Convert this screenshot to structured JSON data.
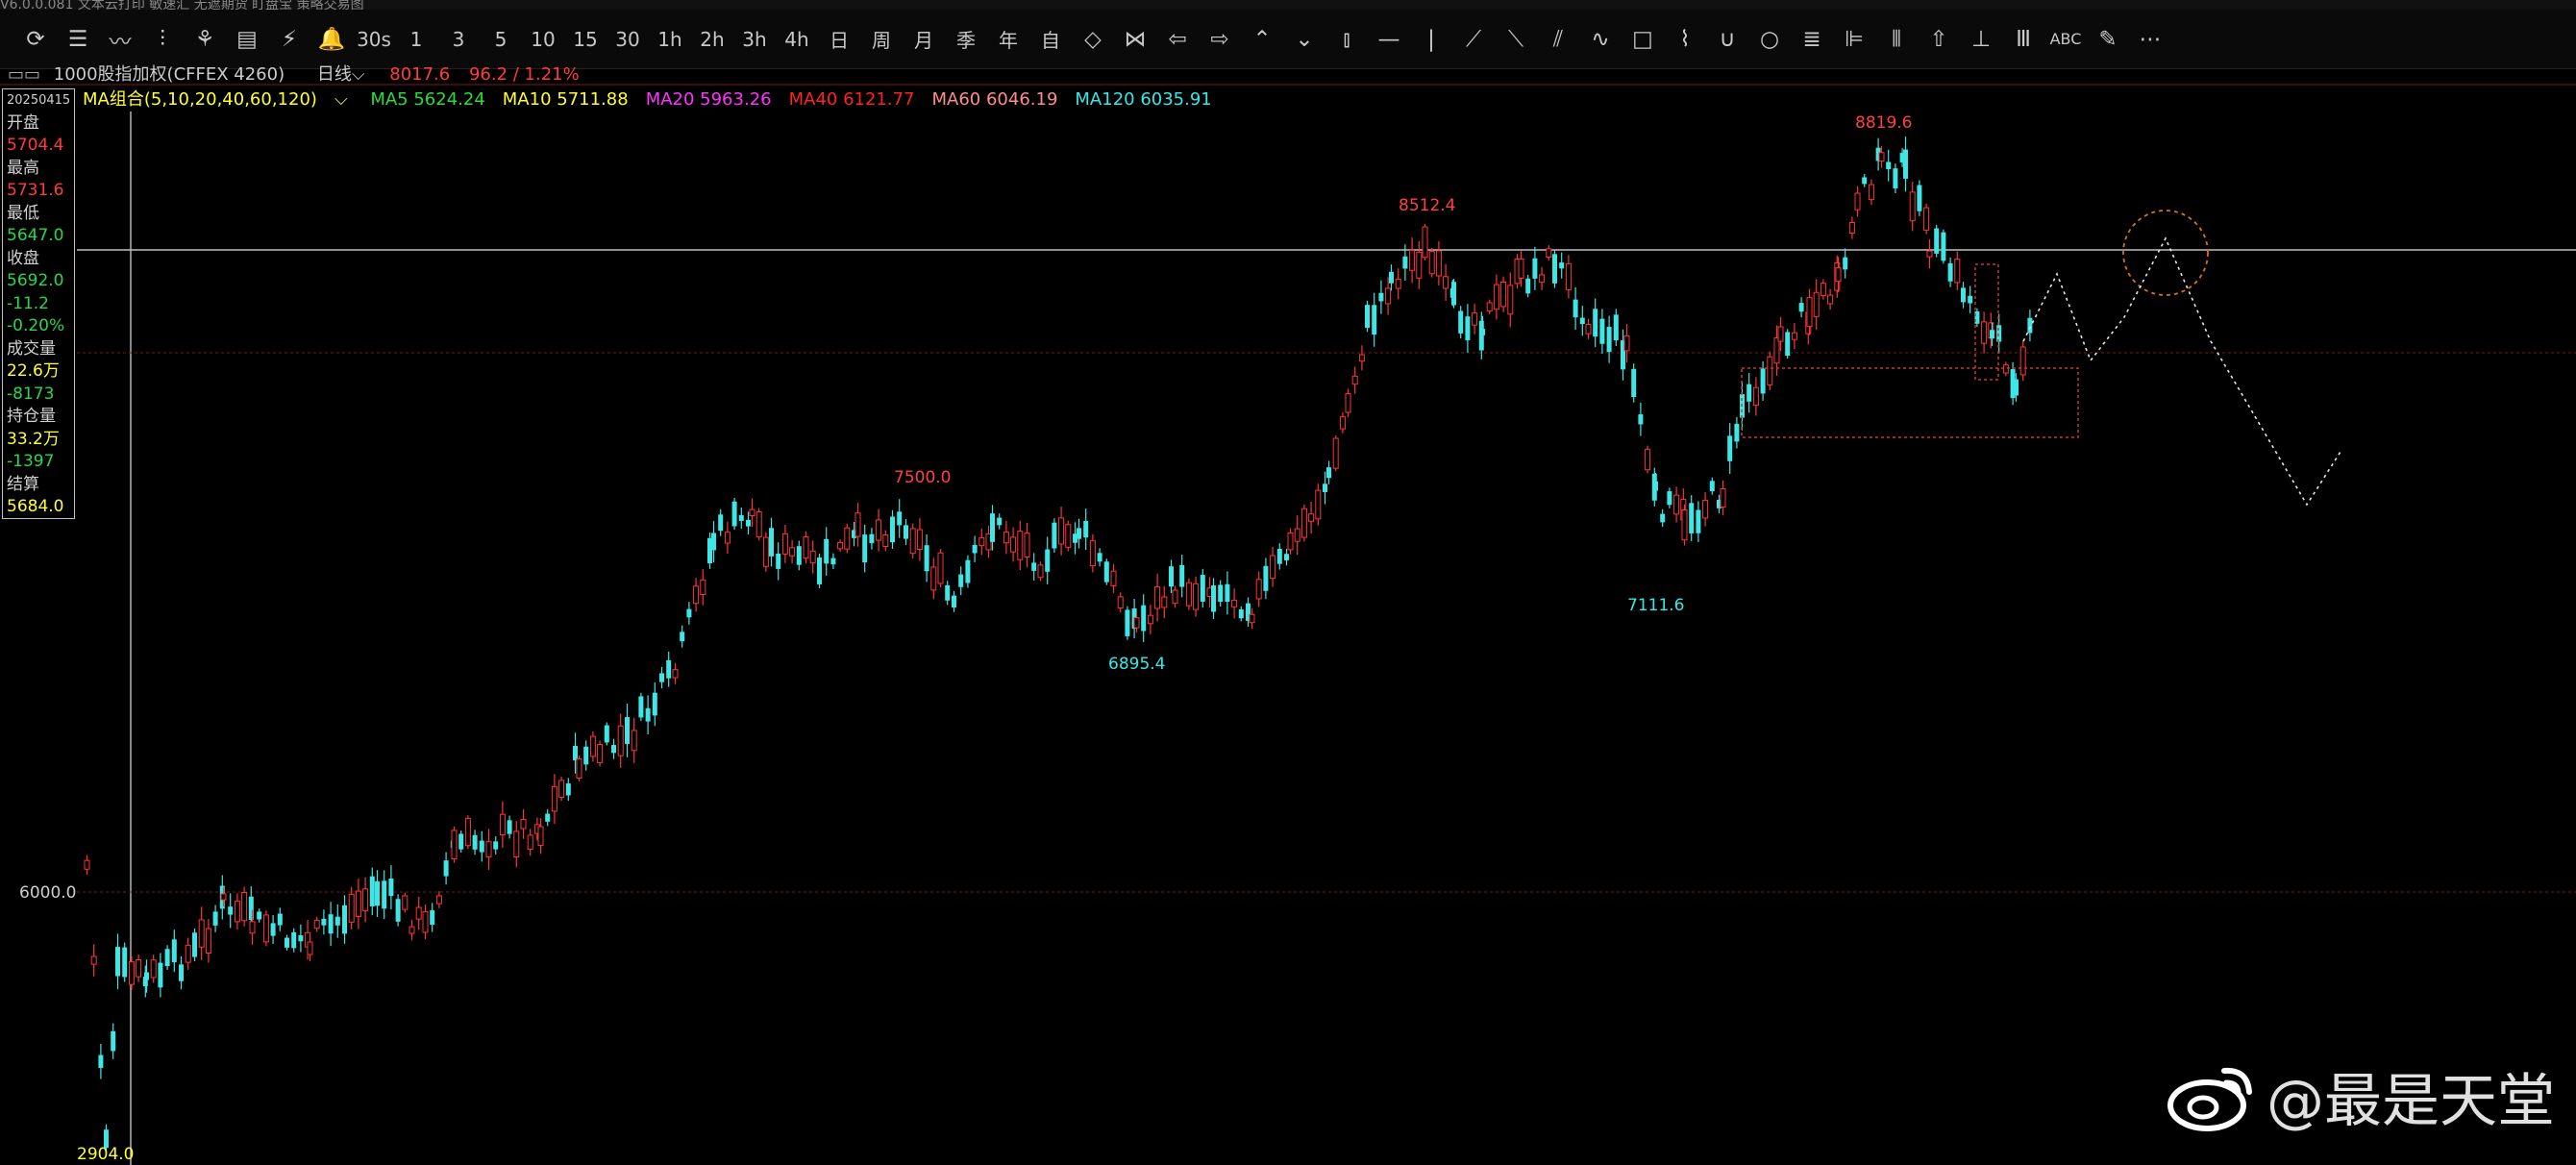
{
  "topbar": {
    "text": "V6.0.0.081    文本云打印  敏速汇    无遮期货  盯盘宝       策略交易图"
  },
  "toolbar": {
    "icons": [
      "refresh-icon",
      "list-icon",
      "line-chart-icon",
      "candlestick-icon",
      "crosshair-icon",
      "kline-icon",
      "lightning-icon",
      "bell-icon",
      "30s-text-icon",
      "1min",
      "3min",
      "5min",
      "10min",
      "15min",
      "30min",
      "1h",
      "2h",
      "3h",
      "4h",
      "day",
      "week",
      "month",
      "season",
      "year",
      "custom",
      "arrows-icon",
      "measure-icon",
      "back-icon",
      "forward-icon",
      "up-icon",
      "down-icon",
      "ruler-icon",
      "hline-icon",
      "vline-icon",
      "segment-icon",
      "ray-icon",
      "parallel-icon",
      "wave-icon",
      "rect-icon",
      "zigzag-icon",
      "arc-icon",
      "circle-icon",
      "gann-icon",
      "fib-icon",
      "period-icon",
      "arrow-up-icon",
      "volume-icon",
      "scale-icon",
      "abc-icon",
      "draw-icon",
      "more-icon"
    ],
    "labels": [
      "30s",
      "1",
      "3",
      "5",
      "10",
      "15",
      "30",
      "1h",
      "2h",
      "3h",
      "4h",
      "日",
      "周",
      "月",
      "季",
      "年",
      "自"
    ]
  },
  "info": {
    "symbol": "1000股指加权(CFFEX 4260)",
    "period": "日线",
    "price": "8017.6",
    "change": "96.2 / 1.21%"
  },
  "ma": {
    "group": "MA组合(5,10,20,40,60,120)",
    "items": [
      {
        "label": "MA5 5624.24",
        "color": "#2bdc38"
      },
      {
        "label": "MA10 5711.88",
        "color": "#ffff33"
      },
      {
        "label": "MA20 5963.26",
        "color": "#ff33ff"
      },
      {
        "label": "MA40 6121.77",
        "color": "#ff2222"
      },
      {
        "label": "MA60 6046.19",
        "color": "#ff8c8c"
      },
      {
        "label": "MA120 6035.91",
        "color": "#36e8e8"
      }
    ]
  },
  "panel": {
    "date": "20250415",
    "open_label": "开盘",
    "open": "5704.4",
    "high_label": "最高",
    "high": "5731.6",
    "low_label": "最低",
    "low": "5647.0",
    "close_label": "收盘",
    "close": "5692.0",
    "change": "-11.2",
    "pct": "-0.20%",
    "vol_label": "成交量",
    "vol": "22.6万",
    "vol_delta": "-8173",
    "oi_label": "持仓量",
    "oi": "33.2万",
    "oi_delta": "-1397",
    "settle_label": "结算",
    "settle": "5684.0"
  },
  "annotations": {
    "high1": "7500.0",
    "low1": "6895.4",
    "high2": "8512.4",
    "low2": "7111.6",
    "high3": "8819.6",
    "price_axis": "6000.0",
    "bottom_low": "2904.0"
  },
  "watermark": {
    "text": "@最是天堂"
  },
  "chart_data": {
    "type": "candlestick",
    "ylim": [
      5000,
      9000
    ],
    "labeled_points": [
      {
        "label": "6000.0",
        "y": 6000
      },
      {
        "label": "7500.0",
        "y": 7500
      },
      {
        "label": "6895.4",
        "y": 6895.4
      },
      {
        "label": "8512.4",
        "y": 8512.4
      },
      {
        "label": "7111.6",
        "y": 7111.6
      },
      {
        "label": "8819.6",
        "y": 8819.6
      }
    ]
  }
}
